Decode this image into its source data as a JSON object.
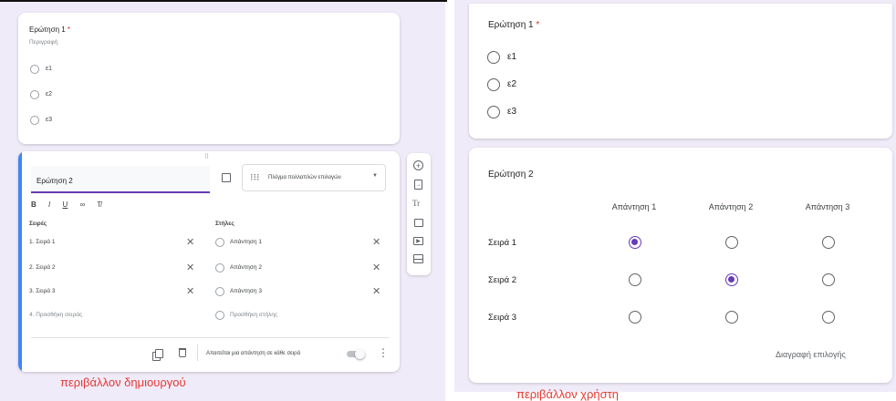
{
  "left": {
    "q1": {
      "title": "Ερώτηση 1",
      "required_mark": "*",
      "description": "Περιγραφή",
      "options": [
        "ε1",
        "ε2",
        "ε3"
      ]
    },
    "q2": {
      "title": "Ερώτηση 2",
      "type_label": "Πλέγμα πολλαπλών επιλογών",
      "format_tools": [
        "B",
        "I",
        "U",
        "∞",
        "T̸"
      ],
      "rows_header": "Σειρές",
      "cols_header": "Στήλες",
      "rows": [
        "1. Σειρά 1",
        "2. Σειρά 2",
        "3. Σειρά 3"
      ],
      "add_row": "4. Προσθήκη σειράς",
      "cols": [
        "Απάντηση 1",
        "Απάντηση 2",
        "Απάντηση 3"
      ],
      "add_col": "Προσθήκη στήλης",
      "required_label": "Απαιτείται μια απάντηση σε κάθε σειρά",
      "more": "⋮"
    },
    "toolbar_icons": [
      "add-question-icon",
      "import-icon",
      "title-icon",
      "image-icon",
      "video-icon",
      "section-icon"
    ],
    "caption": "περιβάλλον δημιουργού"
  },
  "right": {
    "q1": {
      "title": "Ερώτηση 1",
      "required_mark": "*",
      "options": [
        "ε1",
        "ε2",
        "ε3"
      ]
    },
    "q2": {
      "title": "Ερώτηση 2",
      "columns": [
        "Απάντηση 1",
        "Απάντηση 2",
        "Απάντηση 3"
      ],
      "rows": [
        {
          "label": "Σειρά 1",
          "selected": 0
        },
        {
          "label": "Σειρά 2",
          "selected": 1
        },
        {
          "label": "Σειρά 3",
          "selected": -1
        }
      ],
      "clear_label": "Διαγραφή επιλογής"
    },
    "caption": "περιβάλλον χρήστη"
  },
  "colors": {
    "accent": "#673ab7",
    "focus_bar": "#4285f4",
    "caption": "#e53935",
    "background": "#f0ebf8"
  }
}
